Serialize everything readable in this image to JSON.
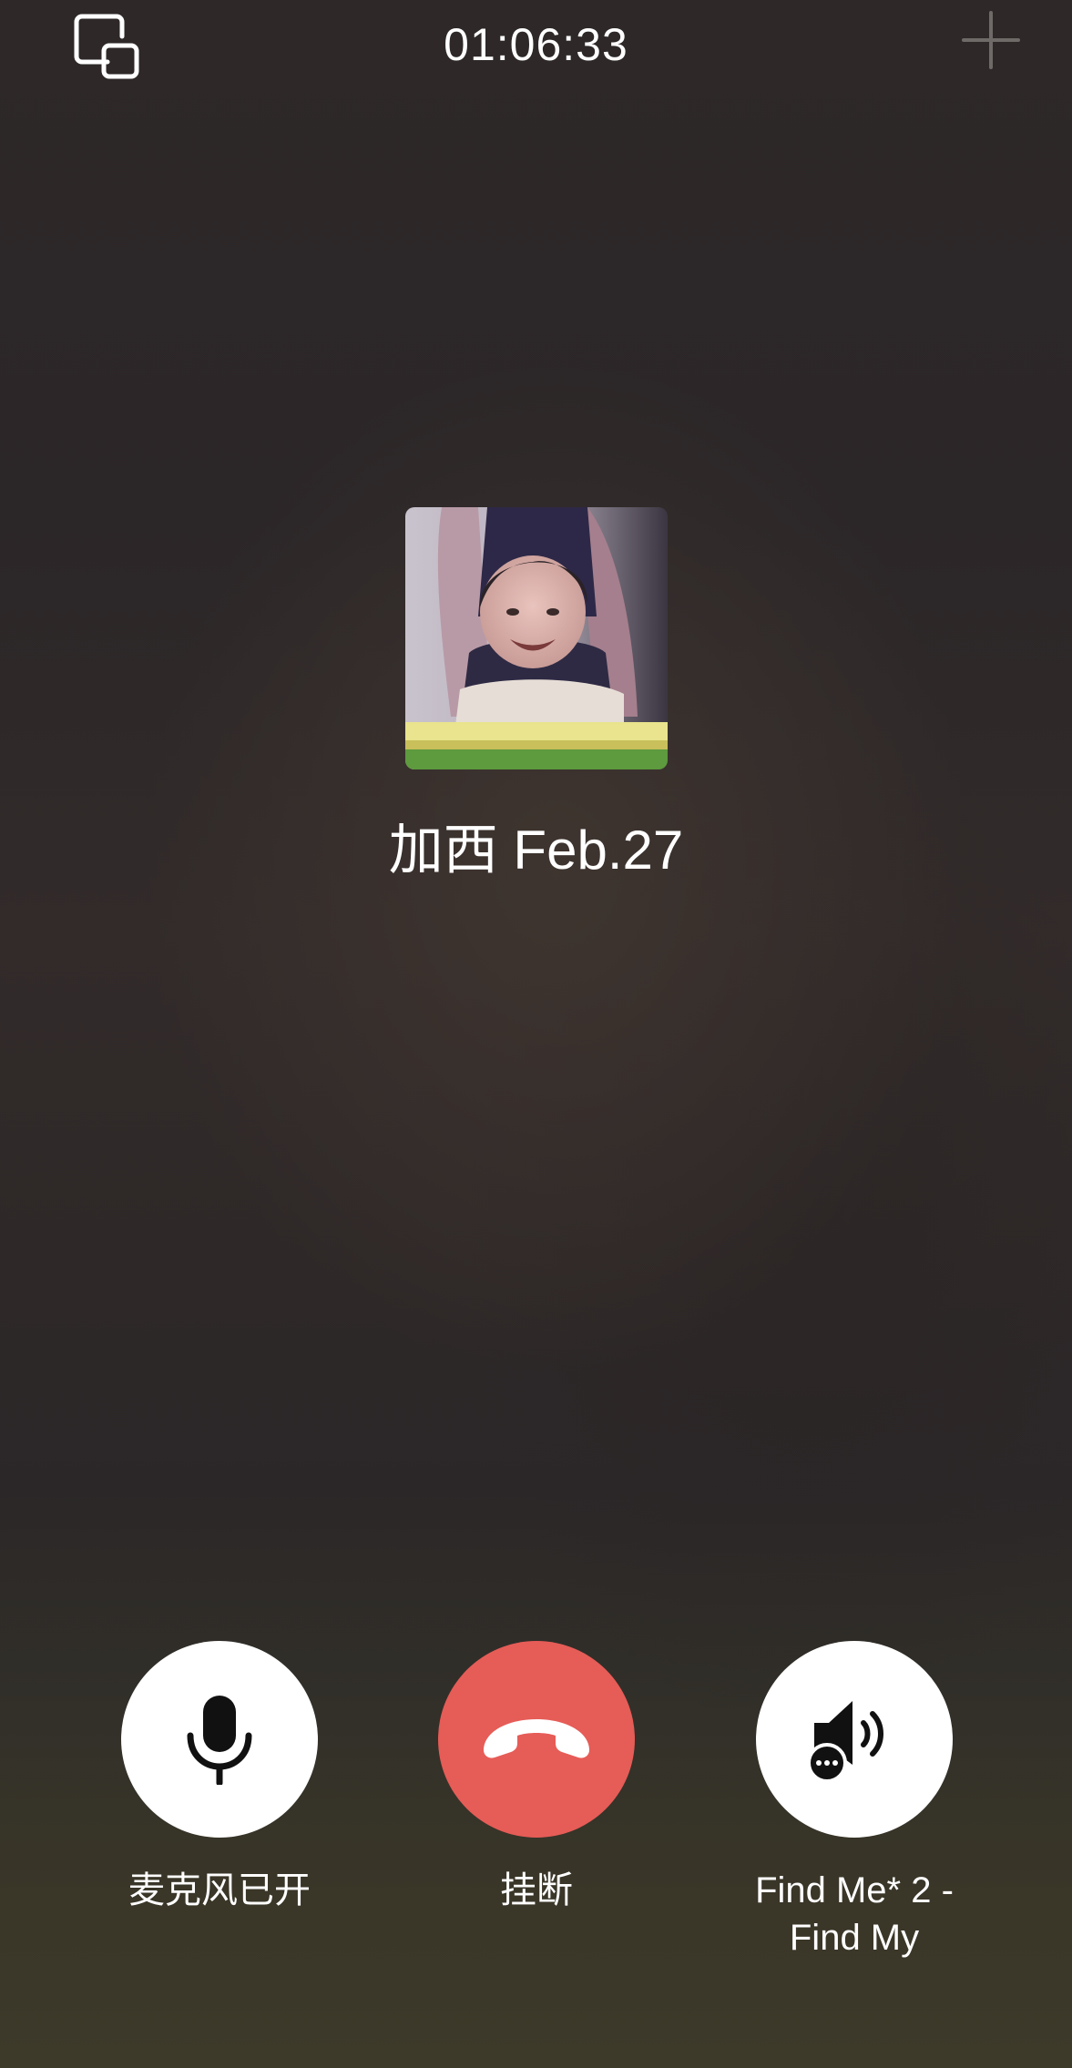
{
  "call": {
    "timer": "01:06:33",
    "caller_name": "加西 Feb.27"
  },
  "controls": {
    "mic_label": "麦克风已开",
    "hangup_label": "挂断",
    "speaker_label": "Find Me* 2 -\nFind My"
  },
  "icons": {
    "minimize": "floating-window-icon",
    "add": "plus-icon",
    "mic": "microphone-icon",
    "hangup": "phone-hangup-icon",
    "speaker": "speaker-bluetooth-icon"
  },
  "colors": {
    "hangup": "#e65c57",
    "control_bg": "#ffffff",
    "icon": "#111111"
  }
}
